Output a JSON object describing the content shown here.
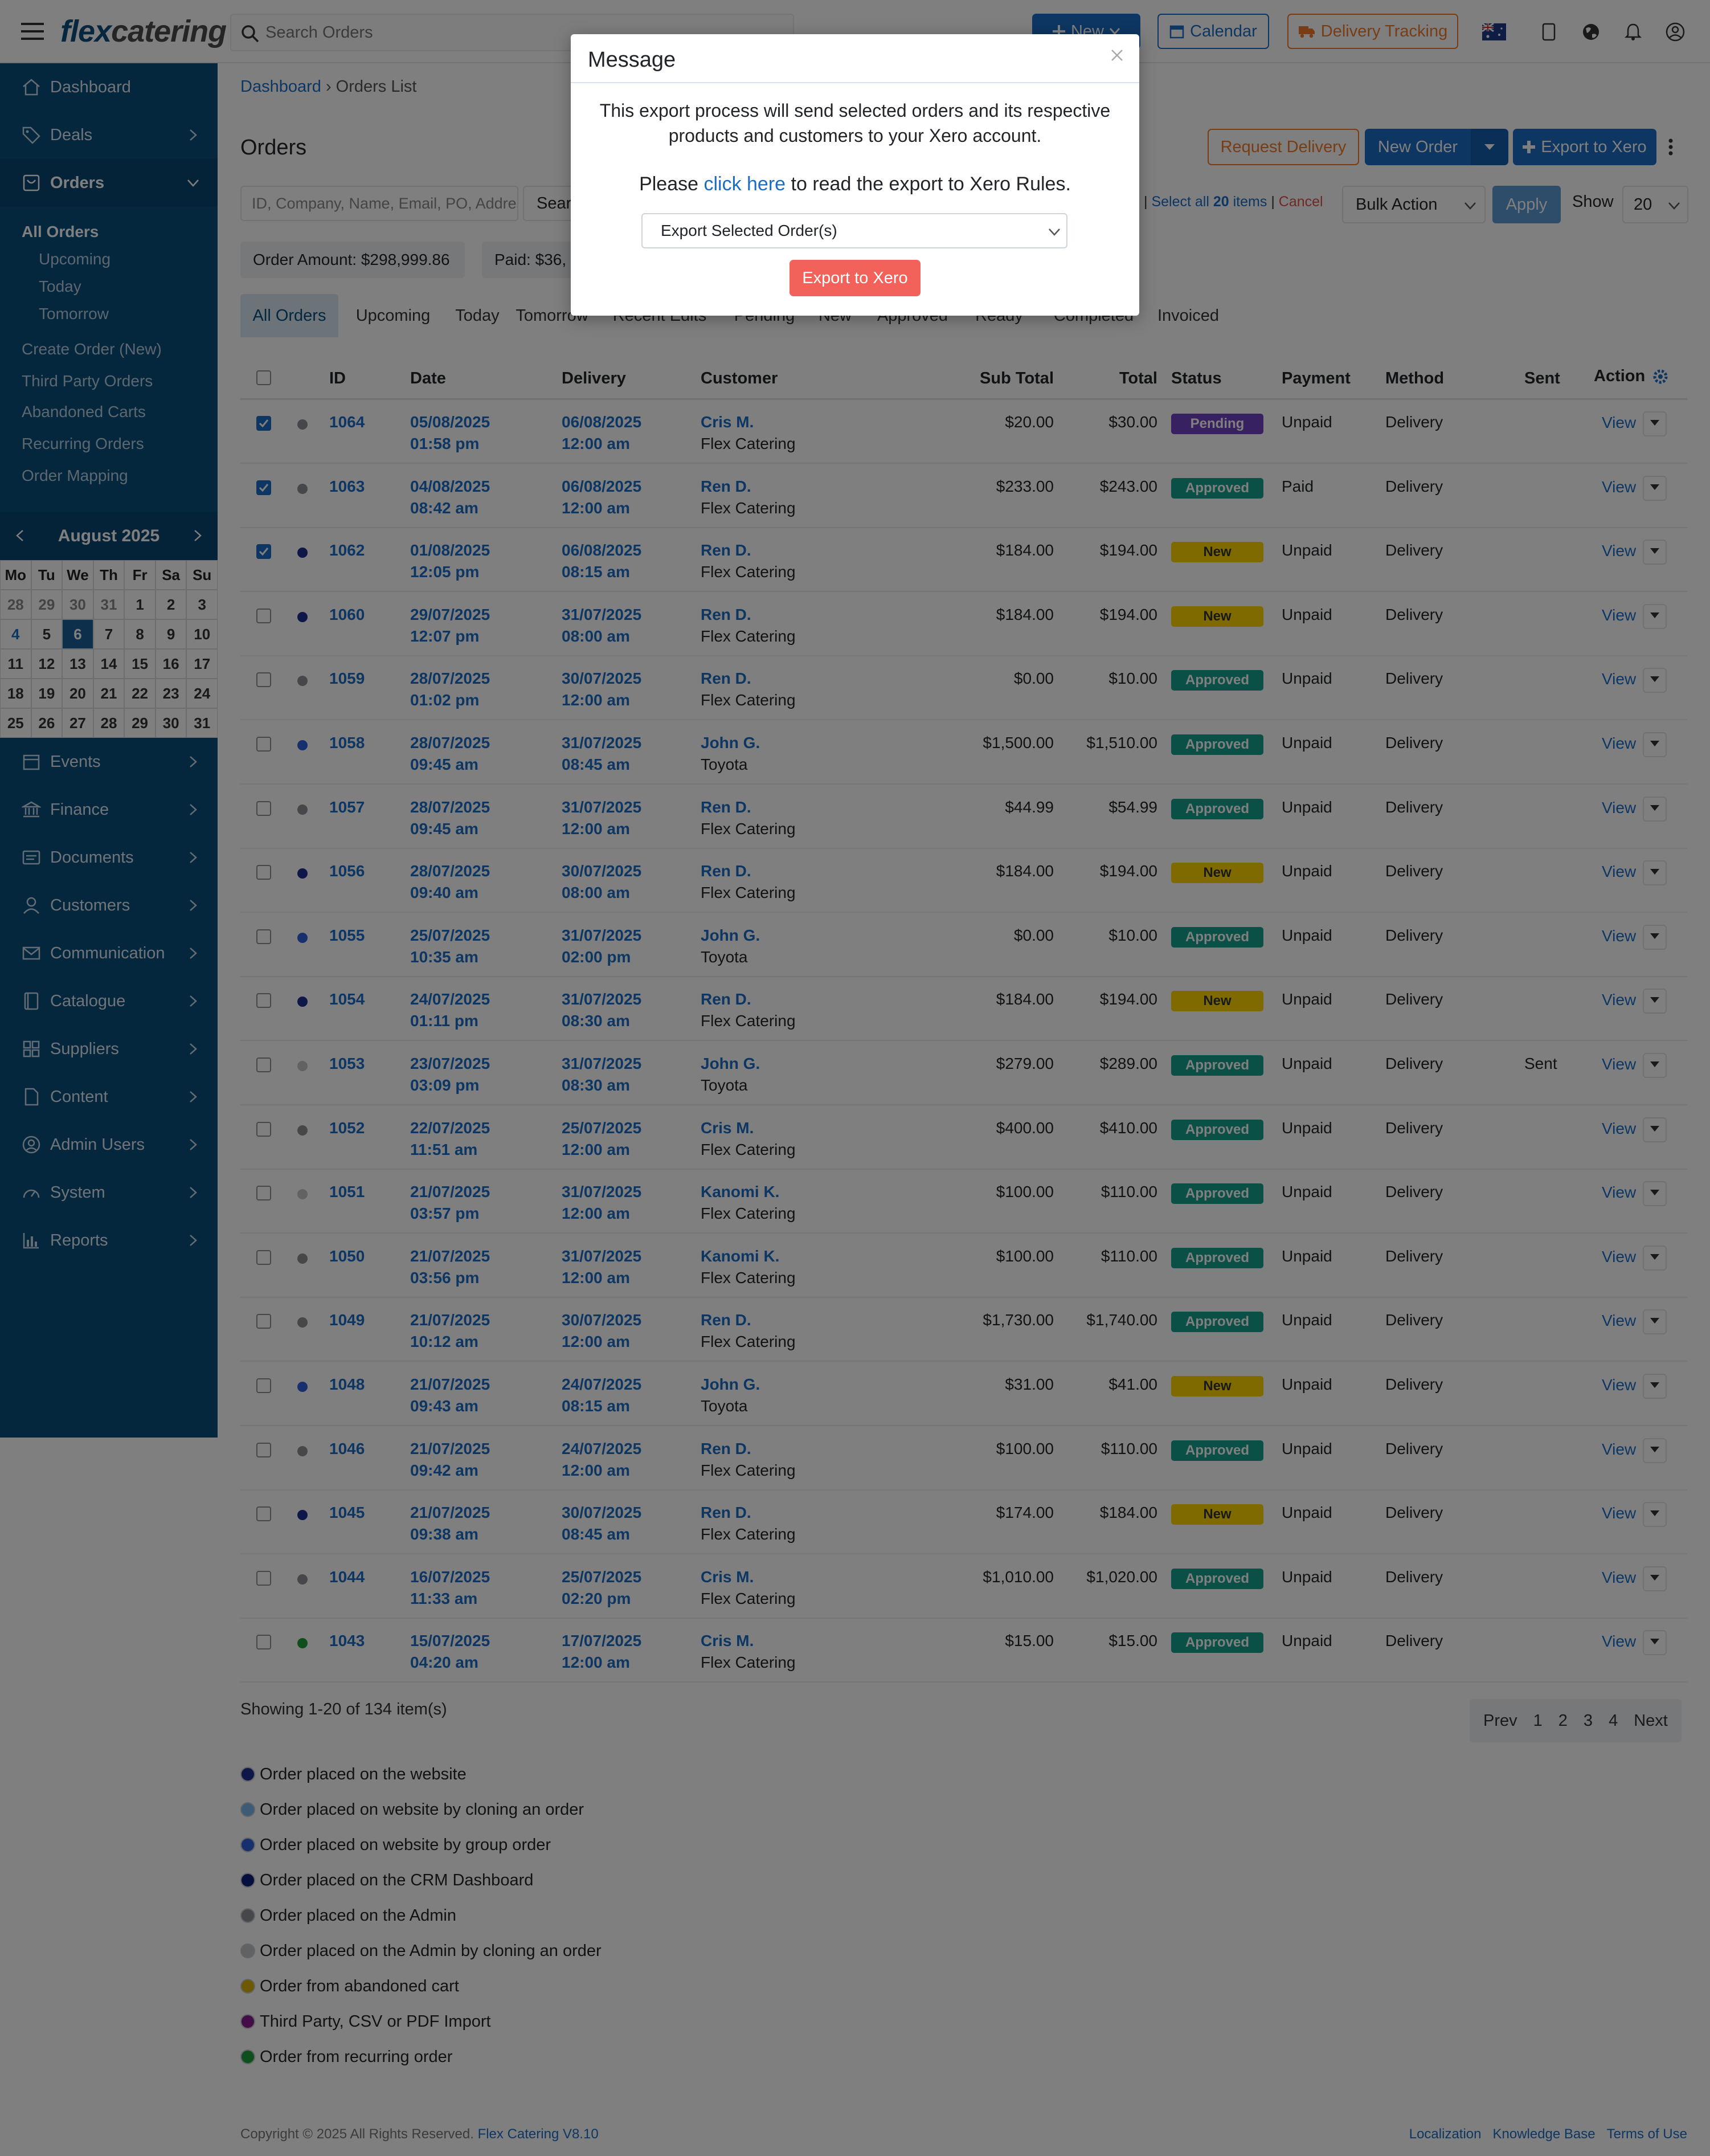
{
  "app": {
    "logo_part1": "flex",
    "logo_part2": "catering",
    "search_placeholder": "Search Orders"
  },
  "topbar": {
    "new_label": "New",
    "calendar_label": "Calendar",
    "delivery_tracking_label": "Delivery Tracking"
  },
  "sidebar": {
    "items": [
      {
        "label": "Dashboard",
        "icon": "home-icon"
      },
      {
        "label": "Deals",
        "icon": "tag-icon"
      },
      {
        "label": "Orders",
        "icon": "cart-icon"
      }
    ],
    "submenu": {
      "all_orders": "All Orders",
      "upcoming": "Upcoming",
      "today": "Today",
      "tomorrow": "Tomorrow",
      "create_order": "Create Order (New)",
      "third_party": "Third Party Orders",
      "abandoned": "Abandoned Carts",
      "recurring": "Recurring Orders",
      "mapping": "Order Mapping"
    },
    "calendar": {
      "month": "August 2025",
      "days": [
        "Mo",
        "Tu",
        "We",
        "Th",
        "Fr",
        "Sa",
        "Su"
      ],
      "cells": [
        "28",
        "29",
        "30",
        "31",
        "1",
        "2",
        "3",
        "4",
        "5",
        "6",
        "7",
        "8",
        "9",
        "10",
        "11",
        "12",
        "13",
        "14",
        "15",
        "16",
        "17",
        "18",
        "19",
        "20",
        "21",
        "22",
        "23",
        "24",
        "25",
        "26",
        "27",
        "28",
        "29",
        "30",
        "31"
      ]
    },
    "lower": [
      {
        "label": "Events",
        "icon": "calendar-icon"
      },
      {
        "label": "Finance",
        "icon": "bank-icon"
      },
      {
        "label": "Documents",
        "icon": "document-icon"
      },
      {
        "label": "Customers",
        "icon": "user-icon"
      },
      {
        "label": "Communication",
        "icon": "envelope-icon"
      },
      {
        "label": "Catalogue",
        "icon": "book-icon"
      },
      {
        "label": "Suppliers",
        "icon": "grid-icon"
      },
      {
        "label": "Content",
        "icon": "file-icon"
      },
      {
        "label": "Admin Users",
        "icon": "user-circle-icon"
      },
      {
        "label": "System",
        "icon": "gauge-icon"
      },
      {
        "label": "Reports",
        "icon": "chart-icon"
      }
    ]
  },
  "main": {
    "breadcrumb": {
      "home": "Dashboard",
      "sep": "›",
      "current": "Orders List"
    },
    "title": "Orders",
    "request_delivery": "Request Delivery",
    "new_order": "New Order",
    "export_xero": "Export to Xero",
    "filter_placeholder": "ID, Company, Name, Email, PO, Address",
    "search_label": "Search",
    "selection": {
      "prefix": "|",
      "select_all": "Select all",
      "count": "20",
      "items": "items",
      "cancel": "Cancel"
    },
    "bulk_action": "Bulk Action",
    "apply": "Apply",
    "show_label": "Show",
    "show_value": "20",
    "order_amount": "Order Amount: $298,999.86",
    "paid": "Paid: $36,",
    "tabs": [
      "All Orders",
      "Upcoming",
      "Today",
      "Tomorrow",
      "Recent Edits",
      "Pending",
      "New",
      "Approved",
      "Ready",
      "Completed",
      "Invoiced"
    ]
  },
  "table": {
    "headers": {
      "id": "ID",
      "date": "Date",
      "delivery": "Delivery",
      "customer": "Customer",
      "subtotal": "Sub Total",
      "total": "Total",
      "status": "Status",
      "payment": "Payment",
      "method": "Method",
      "sent": "Sent",
      "action": "Action"
    },
    "view": "View",
    "rows": [
      {
        "checked": true,
        "dot": "#8a8f94",
        "id": "1064",
        "d1": "05/08/2025",
        "d2": "01:58 pm",
        "v1": "06/08/2025",
        "v2": "12:00 am",
        "cust": "Cris M.",
        "co": "Flex Catering",
        "sub": "$20.00",
        "tot": "$30.00",
        "status": "Pending",
        "pay": "Unpaid",
        "method": "Delivery",
        "sent": ""
      },
      {
        "checked": true,
        "dot": "#8a8f94",
        "id": "1063",
        "d1": "04/08/2025",
        "d2": "08:42 am",
        "v1": "06/08/2025",
        "v2": "12:00 am",
        "cust": "Ren D.",
        "co": "Flex Catering",
        "sub": "$233.00",
        "tot": "$243.00",
        "status": "Approved",
        "pay": "Paid",
        "method": "Delivery",
        "sent": ""
      },
      {
        "checked": true,
        "dot": "#1c2f8f",
        "id": "1062",
        "d1": "01/08/2025",
        "d2": "12:05 pm",
        "v1": "06/08/2025",
        "v2": "08:15 am",
        "cust": "Ren D.",
        "co": "Flex Catering",
        "sub": "$184.00",
        "tot": "$194.00",
        "status": "New",
        "pay": "Unpaid",
        "method": "Delivery",
        "sent": ""
      },
      {
        "checked": false,
        "dot": "#1c2f8f",
        "id": "1060",
        "d1": "29/07/2025",
        "d2": "12:07 pm",
        "v1": "31/07/2025",
        "v2": "08:00 am",
        "cust": "Ren D.",
        "co": "Flex Catering",
        "sub": "$184.00",
        "tot": "$194.00",
        "status": "New",
        "pay": "Unpaid",
        "method": "Delivery",
        "sent": ""
      },
      {
        "checked": false,
        "dot": "#8a8f94",
        "id": "1059",
        "d1": "28/07/2025",
        "d2": "01:02 pm",
        "v1": "30/07/2025",
        "v2": "12:00 am",
        "cust": "Ren D.",
        "co": "Flex Catering",
        "sub": "$0.00",
        "tot": "$10.00",
        "status": "Approved",
        "pay": "Unpaid",
        "method": "Delivery",
        "sent": ""
      },
      {
        "checked": false,
        "dot": "#2e5fd8",
        "id": "1058",
        "d1": "28/07/2025",
        "d2": "09:45 am",
        "v1": "31/07/2025",
        "v2": "08:45 am",
        "cust": "John G.",
        "co": "Toyota",
        "sub": "$1,500.00",
        "tot": "$1,510.00",
        "status": "Approved",
        "pay": "Unpaid",
        "method": "Delivery",
        "sent": ""
      },
      {
        "checked": false,
        "dot": "#8a8f94",
        "id": "1057",
        "d1": "28/07/2025",
        "d2": "09:45 am",
        "v1": "31/07/2025",
        "v2": "12:00 am",
        "cust": "Ren D.",
        "co": "Flex Catering",
        "sub": "$44.99",
        "tot": "$54.99",
        "status": "Approved",
        "pay": "Unpaid",
        "method": "Delivery",
        "sent": ""
      },
      {
        "checked": false,
        "dot": "#1c2f8f",
        "id": "1056",
        "d1": "28/07/2025",
        "d2": "09:40 am",
        "v1": "30/07/2025",
        "v2": "08:00 am",
        "cust": "Ren D.",
        "co": "Flex Catering",
        "sub": "$184.00",
        "tot": "$194.00",
        "status": "New",
        "pay": "Unpaid",
        "method": "Delivery",
        "sent": ""
      },
      {
        "checked": false,
        "dot": "#2e5fd8",
        "id": "1055",
        "d1": "25/07/2025",
        "d2": "10:35 am",
        "v1": "31/07/2025",
        "v2": "02:00 pm",
        "cust": "John G.",
        "co": "Toyota",
        "sub": "$0.00",
        "tot": "$10.00",
        "status": "Approved",
        "pay": "Unpaid",
        "method": "Delivery",
        "sent": ""
      },
      {
        "checked": false,
        "dot": "#1c2f8f",
        "id": "1054",
        "d1": "24/07/2025",
        "d2": "01:11 pm",
        "v1": "31/07/2025",
        "v2": "08:30 am",
        "cust": "Ren D.",
        "co": "Flex Catering",
        "sub": "$184.00",
        "tot": "$194.00",
        "status": "New",
        "pay": "Unpaid",
        "method": "Delivery",
        "sent": ""
      },
      {
        "checked": false,
        "dot": "#c0c4c8",
        "id": "1053",
        "d1": "23/07/2025",
        "d2": "03:09 pm",
        "v1": "31/07/2025",
        "v2": "08:30 am",
        "cust": "John G.",
        "co": "Toyota",
        "sub": "$279.00",
        "tot": "$289.00",
        "status": "Approved",
        "pay": "Unpaid",
        "method": "Delivery",
        "sent": "Sent"
      },
      {
        "checked": false,
        "dot": "#8a8f94",
        "id": "1052",
        "d1": "22/07/2025",
        "d2": "11:51 am",
        "v1": "25/07/2025",
        "v2": "12:00 am",
        "cust": "Cris M.",
        "co": "Flex Catering",
        "sub": "$400.00",
        "tot": "$410.00",
        "status": "Approved",
        "pay": "Unpaid",
        "method": "Delivery",
        "sent": ""
      },
      {
        "checked": false,
        "dot": "#c0c4c8",
        "id": "1051",
        "d1": "21/07/2025",
        "d2": "03:57 pm",
        "v1": "31/07/2025",
        "v2": "12:00 am",
        "cust": "Kanomi K.",
        "co": "Flex Catering",
        "sub": "$100.00",
        "tot": "$110.00",
        "status": "Approved",
        "pay": "Unpaid",
        "method": "Delivery",
        "sent": ""
      },
      {
        "checked": false,
        "dot": "#8a8f94",
        "id": "1050",
        "d1": "21/07/2025",
        "d2": "03:56 pm",
        "v1": "31/07/2025",
        "v2": "12:00 am",
        "cust": "Kanomi K.",
        "co": "Flex Catering",
        "sub": "$100.00",
        "tot": "$110.00",
        "status": "Approved",
        "pay": "Unpaid",
        "method": "Delivery",
        "sent": ""
      },
      {
        "checked": false,
        "dot": "#8a8f94",
        "id": "1049",
        "d1": "21/07/2025",
        "d2": "10:12 am",
        "v1": "30/07/2025",
        "v2": "12:00 am",
        "cust": "Ren D.",
        "co": "Flex Catering",
        "sub": "$1,730.00",
        "tot": "$1,740.00",
        "status": "Approved",
        "pay": "Unpaid",
        "method": "Delivery",
        "sent": ""
      },
      {
        "checked": false,
        "dot": "#2e5fd8",
        "id": "1048",
        "d1": "21/07/2025",
        "d2": "09:43 am",
        "v1": "24/07/2025",
        "v2": "08:15 am",
        "cust": "John G.",
        "co": "Toyota",
        "sub": "$31.00",
        "tot": "$41.00",
        "status": "New",
        "pay": "Unpaid",
        "method": "Delivery",
        "sent": ""
      },
      {
        "checked": false,
        "dot": "#8a8f94",
        "id": "1046",
        "d1": "21/07/2025",
        "d2": "09:42 am",
        "v1": "24/07/2025",
        "v2": "12:00 am",
        "cust": "Ren D.",
        "co": "Flex Catering",
        "sub": "$100.00",
        "tot": "$110.00",
        "status": "Approved",
        "pay": "Unpaid",
        "method": "Delivery",
        "sent": ""
      },
      {
        "checked": false,
        "dot": "#1c2f8f",
        "id": "1045",
        "d1": "21/07/2025",
        "d2": "09:38 am",
        "v1": "30/07/2025",
        "v2": "08:45 am",
        "cust": "Ren D.",
        "co": "Flex Catering",
        "sub": "$174.00",
        "tot": "$184.00",
        "status": "New",
        "pay": "Unpaid",
        "method": "Delivery",
        "sent": ""
      },
      {
        "checked": false,
        "dot": "#8a8f94",
        "id": "1044",
        "d1": "16/07/2025",
        "d2": "11:33 am",
        "v1": "25/07/2025",
        "v2": "02:20 pm",
        "cust": "Cris M.",
        "co": "Flex Catering",
        "sub": "$1,010.00",
        "tot": "$1,020.00",
        "status": "Approved",
        "pay": "Unpaid",
        "method": "Delivery",
        "sent": ""
      },
      {
        "checked": false,
        "dot": "#1f9d3a",
        "id": "1043",
        "d1": "15/07/2025",
        "d2": "04:20 am",
        "v1": "17/07/2025",
        "v2": "12:00 am",
        "cust": "Cris M.",
        "co": "Flex Catering",
        "sub": "$15.00",
        "tot": "$15.00",
        "status": "Approved",
        "pay": "Unpaid",
        "method": "Delivery",
        "sent": ""
      }
    ]
  },
  "status_colors": {
    "Pending": {
      "bg": "#6f42c1",
      "fg": "#fff"
    },
    "Approved": {
      "bg": "#15a08c",
      "fg": "#fff"
    },
    "New": {
      "bg": "#ffd400",
      "fg": "#333"
    }
  },
  "footer_list": {
    "showing": "Showing 1-20 of 134 item(s)",
    "pager": [
      "Prev",
      "1",
      "2",
      "3",
      "4",
      "Next"
    ]
  },
  "legend": [
    {
      "color": "#1c2f8f",
      "label": "Order placed on the website"
    },
    {
      "color": "#7bb6e8",
      "label": "Order placed on website by cloning an order"
    },
    {
      "color": "#2e5fd8",
      "label": "Order placed on website by group order"
    },
    {
      "color": "#0a1f7a",
      "label": "Order placed on the CRM Dashboard"
    },
    {
      "color": "#8a8f94",
      "label": "Order placed on the Admin"
    },
    {
      "color": "#c0c4c8",
      "label": "Order placed on the Admin by cloning an order"
    },
    {
      "color": "#d8b300",
      "label": "Order from abandoned cart"
    },
    {
      "color": "#8a1a8e",
      "label": "Third Party, CSV or PDF Import"
    },
    {
      "color": "#1f9d3a",
      "label": "Order from recurring order"
    }
  ],
  "footer": {
    "copyright": "Copyright © 2025 All Rights Reserved. ",
    "version": "Flex Catering V8.10",
    "links": [
      "Localization",
      "Knowledge Base",
      "Terms of Use"
    ]
  },
  "modal": {
    "title": "Message",
    "body_line1": "This export process will send selected orders and its respective",
    "body_line2": "products and customers to your Xero account.",
    "rules_pre": "Please ",
    "rules_link": "click here",
    "rules_post": " to read the export to Xero Rules.",
    "select_value": "Export Selected Order(s)",
    "button": "Export to Xero"
  }
}
